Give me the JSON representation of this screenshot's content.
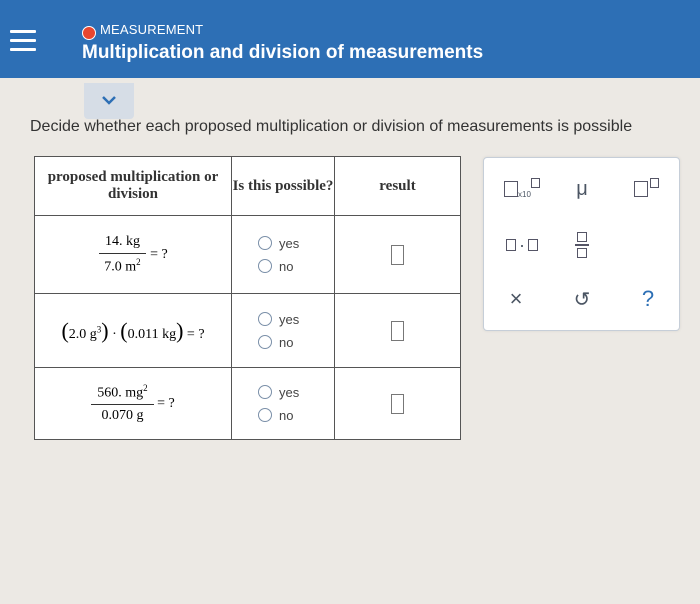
{
  "header": {
    "category": "MEASUREMENT",
    "title": "Multiplication and division of measurements"
  },
  "prompt": "Decide whether each proposed multiplication or division of measurements is possible",
  "table": {
    "headers": [
      "proposed multiplication or division",
      "Is this possible?",
      "result"
    ],
    "rows": [
      {
        "num": "14. kg",
        "den": "7.0 m",
        "den_exp": "2",
        "tail": "= ?",
        "yes": "yes",
        "no": "no"
      },
      {
        "a_val": "2.0 g",
        "a_exp": "3",
        "dot": "·",
        "b_val": "0.011 kg",
        "tail": "= ?",
        "yes": "yes",
        "no": "no"
      },
      {
        "num": "560. mg",
        "num_exp": "2",
        "den": "0.070 g",
        "tail": "= ?",
        "yes": "yes",
        "no": "no"
      }
    ]
  },
  "palette": {
    "times_ten": "x10",
    "micro": "μ",
    "dot": "·",
    "clear": "×",
    "undo": "↺",
    "help": "?"
  },
  "colors": {
    "header": "#2d6fb5",
    "accent_dot": "#e8462f"
  }
}
